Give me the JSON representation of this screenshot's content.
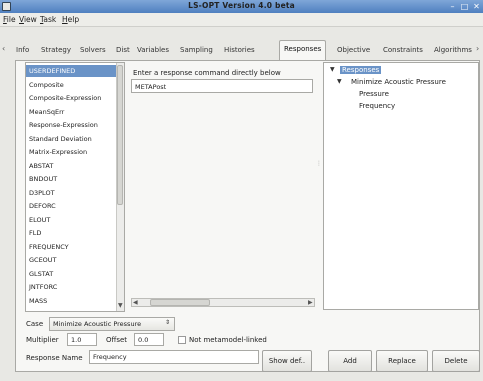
{
  "window": {
    "title": "LS-OPT Version 4.0 beta"
  },
  "menu": {
    "items": [
      {
        "key": "F",
        "rest": "ile"
      },
      {
        "key": "V",
        "rest": "iew"
      },
      {
        "key": "T",
        "rest": "ask"
      },
      {
        "key": "H",
        "rest": "elp"
      }
    ]
  },
  "tabs": [
    "Info",
    "Strategy",
    "Solvers",
    "Dist",
    "Variables",
    "Sampling",
    "Histories",
    "Responses",
    "Objective",
    "Constraints",
    "Algorithms"
  ],
  "active_tab": "Responses",
  "response_types": [
    "USERDEFINED",
    "Composite",
    "Composite-Expression",
    "MeanSqErr",
    "Response-Expression",
    "Standard Deviation",
    "Matrix-Expression",
    "ABSTAT",
    "BNDOUT",
    "D3PLOT",
    "DEFORC",
    "ELOUT",
    "FLD",
    "FREQUENCY",
    "GCEOUT",
    "GLSTAT",
    "JNTFORC",
    "MASS"
  ],
  "selected_type": "USERDEFINED",
  "command": {
    "label": "Enter a response command directly below",
    "value": "METAPost"
  },
  "tree": {
    "root": "Responses",
    "case": "Minimize Acoustic Pressure",
    "children": [
      "Pressure",
      "Frequency"
    ]
  },
  "case": {
    "label": "Case",
    "value": "Minimize Acoustic Pressure"
  },
  "multiplier": {
    "label": "Multiplier",
    "value": "1.0"
  },
  "offset": {
    "label": "Offset",
    "value": "0.0"
  },
  "metamodel": {
    "label": "Not metamodel-linked",
    "checked": false
  },
  "response_name": {
    "label": "Response Name",
    "value": "Frequency"
  },
  "buttons": {
    "show_def": "Show def..",
    "add": "Add",
    "replace": "Replace",
    "delete": "Delete"
  },
  "colors": {
    "titlebar": "#5b89c7",
    "selection": "#6a93c7"
  }
}
